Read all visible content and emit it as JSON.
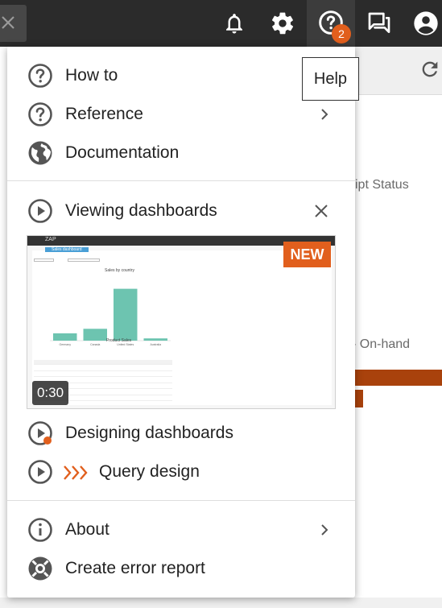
{
  "topbar": {
    "close_icon": "close-icon",
    "icons": [
      "bell-icon",
      "gear-icon",
      "help-icon",
      "chat-icon",
      "account-icon"
    ],
    "help_badge": "2"
  },
  "tooltip": {
    "text": "Help"
  },
  "background": {
    "text1": "ipt Status",
    "text2": "- On-hand",
    "accent": "#a9420c"
  },
  "menu": {
    "top_items": [
      {
        "label": "How to",
        "icon": "question-circle-icon"
      },
      {
        "label": "Reference",
        "icon": "question-circle-icon",
        "has_submenu": true
      },
      {
        "label": "Documentation",
        "icon": "globe-icon"
      }
    ],
    "videos": {
      "featured": {
        "label": "Viewing dashboards",
        "badge": "NEW",
        "duration": "0:30",
        "thumbnail": {
          "app_name": "ZAP",
          "tab_title": "Sales dashboard",
          "chart_title": "Sales by country",
          "categories": [
            "Germany",
            "Canada",
            "United States",
            "Australia"
          ],
          "values": [
            650,
            1050,
            4600,
            200
          ],
          "ylim": [
            0,
            5000
          ],
          "table_title": "Product Sales"
        }
      },
      "items": [
        {
          "label": "Designing dashboards",
          "icon": "play-circle-icon",
          "unwatched_dot": true
        },
        {
          "label": "Query design",
          "icon": "play-circle-icon",
          "decoration": "chevrons-icon"
        }
      ]
    },
    "bottom_items": [
      {
        "label": "About",
        "icon": "info-circle-icon",
        "has_submenu": true
      },
      {
        "label": "Create error report",
        "icon": "lifebuoy-icon"
      }
    ]
  },
  "colors": {
    "accent": "#e15f1d",
    "topbar": "#2b2b2b",
    "chart_bar": "#6dc4b0"
  }
}
